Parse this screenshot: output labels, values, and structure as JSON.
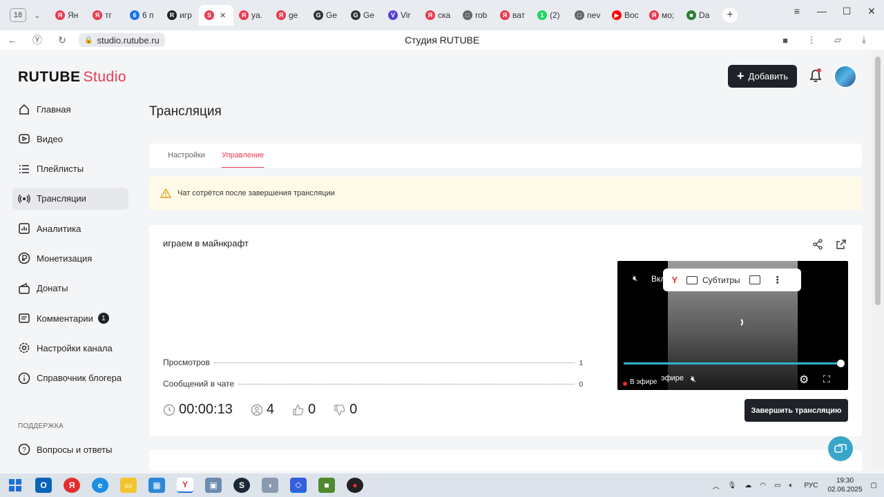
{
  "browser": {
    "tab_count": "18",
    "tabs": [
      {
        "label": "Ян",
        "color": "#e83a52",
        "glyph": "Я"
      },
      {
        "label": "тг",
        "color": "#e83a52",
        "glyph": "Я"
      },
      {
        "label": "6 п",
        "color": "#1a73e8",
        "glyph": "6"
      },
      {
        "label": "игр",
        "color": "#222222",
        "glyph": "R"
      },
      {
        "label": "",
        "color": "#e83a52",
        "glyph": "S"
      },
      {
        "label": "ya.",
        "color": "#e83a52",
        "glyph": "Я"
      },
      {
        "label": "ge",
        "color": "#e83a52",
        "glyph": "Я"
      },
      {
        "label": "Ge",
        "color": "#333333",
        "glyph": "G"
      },
      {
        "label": "Ge",
        "color": "#333333",
        "glyph": "G"
      },
      {
        "label": "Vir",
        "color": "#5b3fd6",
        "glyph": "V"
      },
      {
        "label": "ска",
        "color": "#e83a52",
        "glyph": "Я"
      },
      {
        "label": "rob",
        "color": "#666666",
        "glyph": "□"
      },
      {
        "label": "ват",
        "color": "#e83a52",
        "glyph": "Я"
      },
      {
        "label": "(2)",
        "color": "#25d366",
        "glyph": "1"
      },
      {
        "label": "nev",
        "color": "#666666",
        "glyph": "□"
      },
      {
        "label": "Вос",
        "color": "#ff0000",
        "glyph": "▶"
      },
      {
        "label": "мо;",
        "color": "#e83a52",
        "glyph": "Я"
      },
      {
        "label": "Da",
        "color": "#2e7d32",
        "glyph": "■"
      }
    ],
    "active_tab_index": 4,
    "url": "studio.rutube.ru",
    "page_title": "Студия RUTUBE"
  },
  "header": {
    "logo_main": "RUTUBE",
    "logo_sub": "Studio",
    "add_button": "Добавить"
  },
  "sidebar": {
    "items": [
      {
        "label": "Главная",
        "icon": "home-icon"
      },
      {
        "label": "Видео",
        "icon": "video-icon"
      },
      {
        "label": "Плейлисты",
        "icon": "playlist-icon"
      },
      {
        "label": "Трансляции",
        "icon": "broadcast-icon",
        "active": true
      },
      {
        "label": "Аналитика",
        "icon": "analytics-icon"
      },
      {
        "label": "Монетизация",
        "icon": "ruble-icon"
      },
      {
        "label": "Донаты",
        "icon": "donate-icon"
      },
      {
        "label": "Комментарии",
        "icon": "comment-icon",
        "badge": "1"
      },
      {
        "label": "Настройки канала",
        "icon": "gear-icon"
      },
      {
        "label": "Справочник блогера",
        "icon": "info-icon"
      }
    ],
    "support_label": "ПОДДЕРЖКА",
    "support_item": "Вопросы и ответы"
  },
  "main": {
    "title": "Трансляция",
    "tabs": [
      "Настройки",
      "Управление"
    ],
    "active_tab": 1,
    "warning": "Чат сотрётся после завершения трансляции",
    "stream": {
      "title": "играем в майнкрафт",
      "stats": [
        {
          "label": "Просмотров",
          "value": "1"
        },
        {
          "label": "Сообщений в чате",
          "value": "0"
        }
      ],
      "duration": "00:00:13",
      "viewers": "4",
      "likes": "0",
      "dislikes": "0",
      "end_button": "Завершить трансляцию"
    },
    "player": {
      "subtitles": "Субтитры",
      "mute_text": "Вкл",
      "live_label": "В эфире",
      "live_label_2": "эфире"
    }
  },
  "taskbar": {
    "lang": "РУС",
    "time": "19:30",
    "date": "02.06.2025"
  },
  "colors": {
    "accent": "#e83a52",
    "dark_button": "#1f2329",
    "progress": "#2fb3d6"
  }
}
